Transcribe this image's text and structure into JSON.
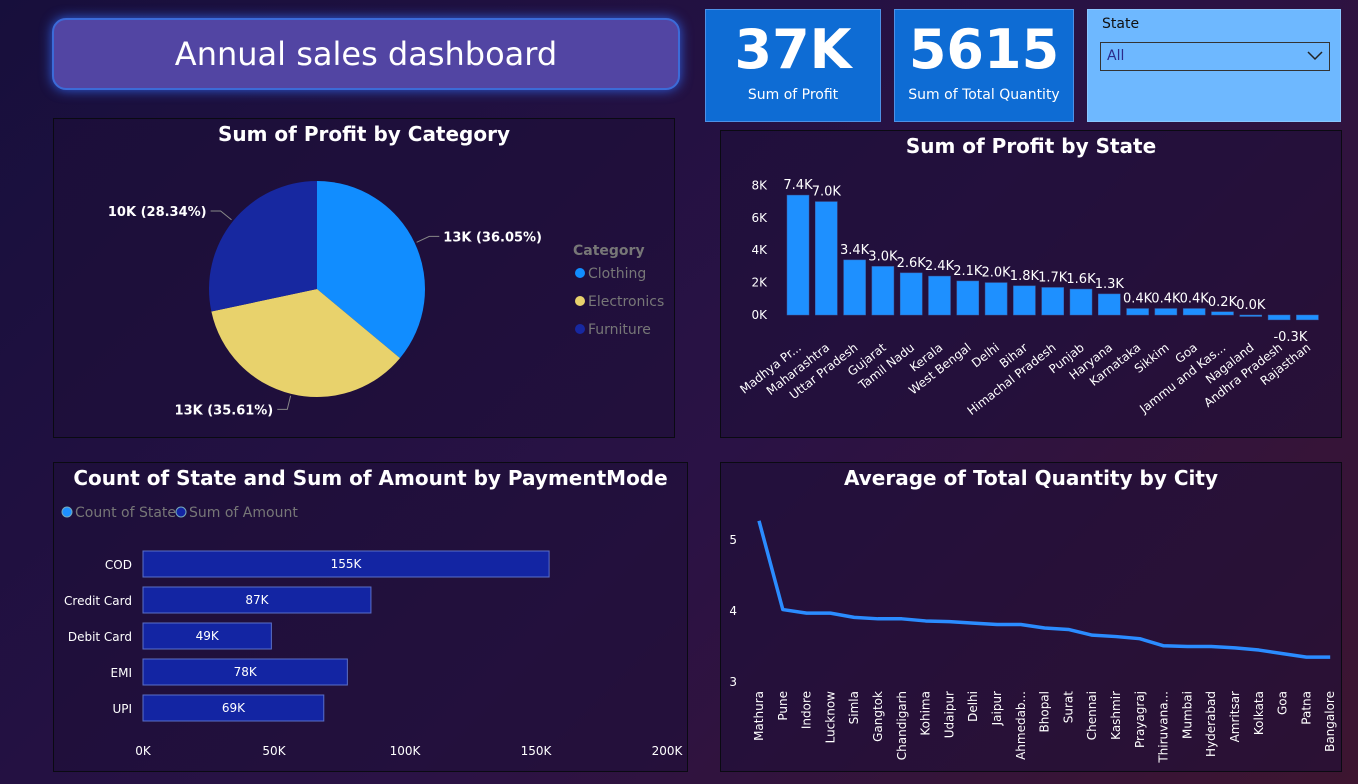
{
  "header": {
    "title": "Annual sales dashboard"
  },
  "kpis": [
    {
      "value": "37K",
      "label": "Sum of Profit"
    },
    {
      "value": "5615",
      "label": "Sum of Total Quantity"
    }
  ],
  "slicer": {
    "label": "State",
    "selected": "All"
  },
  "colors": {
    "clothing": "#118dff",
    "electronics": "#e8d26c",
    "furniture": "#1728a0",
    "bar": "#1e90ff",
    "hbar": "#1325a3",
    "line": "#2b8cff"
  },
  "chart_data": [
    {
      "type": "pie",
      "title": "Sum of Profit by Category",
      "legend_title": "Category",
      "categories": [
        "Clothing",
        "Electronics",
        "Furniture"
      ],
      "values": [
        13000,
        13000,
        10000
      ],
      "percentages": [
        36.05,
        35.61,
        28.34
      ],
      "data_labels": [
        "13K (36.05%)",
        "13K (35.61%)",
        "10K (28.34%)"
      ],
      "legend_position": "right"
    },
    {
      "type": "bar",
      "title": "Sum of Profit by State",
      "categories": [
        "Madhya Pr...",
        "Maharashtra",
        "Uttar Pradesh",
        "Gujarat",
        "Tamil Nadu",
        "Kerala",
        "West Bengal",
        "Delhi",
        "Bihar",
        "Himachal Pradesh",
        "Punjab",
        "Haryana",
        "Karnataka",
        "Sikkim",
        "Goa",
        "Jammu and Kas...",
        "Nagaland",
        "Andhra Pradesh",
        "Rajasthan"
      ],
      "values": [
        7.4,
        7.0,
        3.4,
        3.0,
        2.6,
        2.4,
        2.1,
        2.0,
        1.8,
        1.7,
        1.6,
        1.3,
        0.4,
        0.4,
        0.4,
        0.2,
        0.0,
        -0.3,
        -0.3
      ],
      "data_labels": [
        "7.4K",
        "7.0K",
        "3.4K",
        "3.0K",
        "2.6K",
        "2.4K",
        "2.1K",
        "2.0K",
        "1.8K",
        "1.7K",
        "1.6K",
        "1.3K",
        "0.4K",
        "0.4K",
        "0.4K",
        "0.2K",
        "0.0K",
        "",
        "-0.3K"
      ],
      "y_ticks": [
        "0K",
        "2K",
        "4K",
        "6K",
        "8K"
      ],
      "ylim": [
        -0.3,
        8
      ],
      "value_unit": "thousands"
    },
    {
      "type": "bar",
      "orientation": "horizontal",
      "title": "Count of State and Sum of Amount by PaymentMode",
      "legend": [
        "Count of State",
        "Sum of Amount"
      ],
      "categories": [
        "COD",
        "Credit Card",
        "Debit Card",
        "EMI",
        "UPI"
      ],
      "series": [
        {
          "name": "Sum of Amount",
          "values": [
            155000,
            87000,
            49000,
            78000,
            69000
          ]
        }
      ],
      "data_labels": [
        "155K",
        "87K",
        "49K",
        "78K",
        "69K"
      ],
      "x_ticks": [
        "0K",
        "50K",
        "100K",
        "150K",
        "200K"
      ],
      "xlim": [
        0,
        200000
      ]
    },
    {
      "type": "line",
      "title": "Average of Total Quantity by City",
      "categories": [
        "Mathura",
        "Pune",
        "Indore",
        "Lucknow",
        "Simla",
        "Gangtok",
        "Chandigarh",
        "Kohima",
        "Udaipur",
        "Delhi",
        "Jaipur",
        "Ahmedab...",
        "Bhopal",
        "Surat",
        "Chennai",
        "Kashmir",
        "Prayagraj",
        "Thiruvana...",
        "Mumbai",
        "Hyderabad",
        "Amritsar",
        "Kolkata",
        "Goa",
        "Patna",
        "Bangalore"
      ],
      "values": [
        5.27,
        4.02,
        3.97,
        3.97,
        3.91,
        3.89,
        3.89,
        3.86,
        3.85,
        3.83,
        3.81,
        3.81,
        3.76,
        3.74,
        3.66,
        3.64,
        3.61,
        3.51,
        3.5,
        3.5,
        3.48,
        3.45,
        3.4,
        3.35,
        3.35
      ],
      "y_ticks": [
        "3",
        "4",
        "5"
      ],
      "ylim": [
        3,
        5.4
      ]
    }
  ]
}
